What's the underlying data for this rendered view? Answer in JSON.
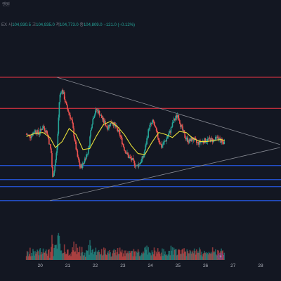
{
  "header": {
    "top_label": "랜원",
    "symbol_suffix": "EX",
    "ohlc": {
      "o_label": "시",
      "o": "104,930.5",
      "h_label": "고",
      "h": "104,935.0",
      "l_label": "저",
      "l": "104,773.0",
      "c_label": "종",
      "c": "104,809.0",
      "change": "−121.0 (−0.12%)"
    }
  },
  "icons": {
    "replay": "lightning-icon"
  },
  "colors": {
    "background": "#131722",
    "up": "#26a69a",
    "down": "#ef5350",
    "ma": "#e8e03a",
    "resistance": "#f23645",
    "support": "#2962ff",
    "trendline": "#8a8d96"
  },
  "chart_data": {
    "type": "candlestick",
    "x_ticks": [
      "20",
      "21",
      "22",
      "23",
      "24",
      "25",
      "26",
      "27",
      "28"
    ],
    "y_range": [
      98000,
      112000
    ],
    "close_series": [
      [
        19.5,
        105600
      ],
      [
        19.65,
        105400
      ],
      [
        19.8,
        106000
      ],
      [
        19.95,
        105700
      ],
      [
        20.1,
        106400
      ],
      [
        20.25,
        105800
      ],
      [
        20.4,
        103800
      ],
      [
        20.45,
        101200
      ],
      [
        20.55,
        102800
      ],
      [
        20.62,
        104500
      ],
      [
        20.7,
        109300
      ],
      [
        20.78,
        110100
      ],
      [
        20.85,
        109600
      ],
      [
        20.95,
        108400
      ],
      [
        21.05,
        107700
      ],
      [
        21.15,
        106900
      ],
      [
        21.25,
        105100
      ],
      [
        21.35,
        103400
      ],
      [
        21.45,
        102300
      ],
      [
        21.55,
        102600
      ],
      [
        21.65,
        103400
      ],
      [
        21.75,
        104000
      ],
      [
        21.85,
        106400
      ],
      [
        21.95,
        107600
      ],
      [
        22.05,
        108100
      ],
      [
        22.15,
        107700
      ],
      [
        22.3,
        106900
      ],
      [
        22.45,
        106300
      ],
      [
        22.6,
        106900
      ],
      [
        22.75,
        106300
      ],
      [
        22.9,
        105500
      ],
      [
        23.05,
        104200
      ],
      [
        23.2,
        103400
      ],
      [
        23.35,
        103000
      ],
      [
        23.5,
        102400
      ],
      [
        23.65,
        102900
      ],
      [
        23.75,
        103400
      ],
      [
        23.85,
        104800
      ],
      [
        23.95,
        106300
      ],
      [
        24.1,
        106900
      ],
      [
        24.25,
        105500
      ],
      [
        24.4,
        104400
      ],
      [
        24.55,
        105000
      ],
      [
        24.7,
        105800
      ],
      [
        24.85,
        107000
      ],
      [
        25.0,
        107600
      ],
      [
        25.1,
        106500
      ],
      [
        25.25,
        105400
      ],
      [
        25.4,
        104900
      ],
      [
        25.55,
        105200
      ],
      [
        25.7,
        104700
      ],
      [
        25.85,
        104900
      ],
      [
        26.0,
        105000
      ],
      [
        26.15,
        105100
      ],
      [
        26.3,
        105000
      ],
      [
        26.45,
        105300
      ],
      [
        26.6,
        104800
      ],
      [
        26.7,
        104809
      ]
    ],
    "moving_average": [
      [
        19.5,
        105400
      ],
      [
        19.8,
        105700
      ],
      [
        20.1,
        105800
      ],
      [
        20.35,
        105300
      ],
      [
        20.55,
        104300
      ],
      [
        20.8,
        104900
      ],
      [
        21.05,
        106200
      ],
      [
        21.3,
        105600
      ],
      [
        21.55,
        104100
      ],
      [
        21.8,
        104200
      ],
      [
        22.05,
        105500
      ],
      [
        22.3,
        106600
      ],
      [
        22.55,
        106900
      ],
      [
        22.8,
        106400
      ],
      [
        23.05,
        105600
      ],
      [
        23.3,
        104500
      ],
      [
        23.55,
        103700
      ],
      [
        23.8,
        103600
      ],
      [
        24.05,
        104800
      ],
      [
        24.3,
        105800
      ],
      [
        24.55,
        105600
      ],
      [
        24.8,
        105300
      ],
      [
        25.05,
        105900
      ],
      [
        25.3,
        105800
      ],
      [
        25.55,
        105200
      ],
      [
        25.8,
        104900
      ],
      [
        26.05,
        104900
      ],
      [
        26.3,
        105000
      ],
      [
        26.55,
        105100
      ],
      [
        26.7,
        105000
      ]
    ],
    "horizontal_levels": [
      {
        "value": 111300,
        "kind": "resistance"
      },
      {
        "value": 108200,
        "kind": "resistance"
      },
      {
        "value": 102500,
        "kind": "support"
      },
      {
        "value": 101100,
        "kind": "support"
      },
      {
        "value": 100400,
        "kind": "support"
      },
      {
        "value": 99000,
        "kind": "support"
      }
    ],
    "trendlines": [
      {
        "from": [
          20.6,
          111300
        ],
        "to": [
          28.7,
          104600
        ]
      },
      {
        "from": [
          20.35,
          99000
        ],
        "to": [
          28.7,
          104300
        ]
      }
    ],
    "grid": false,
    "legend": "none"
  }
}
